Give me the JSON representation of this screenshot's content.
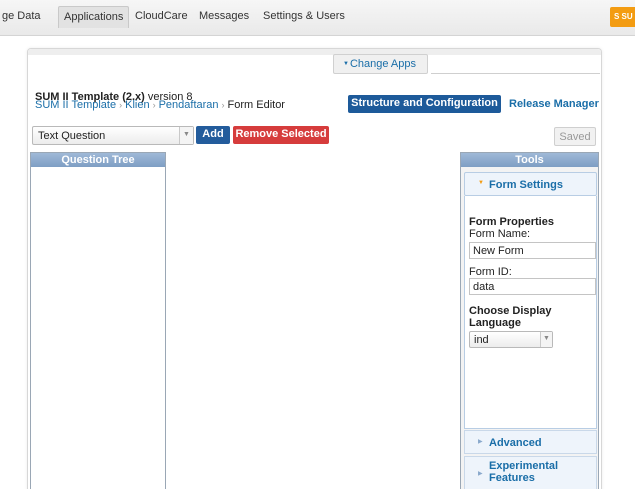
{
  "nav": {
    "items": [
      "ge Data",
      "Applications",
      "CloudCare",
      "Messages",
      "Settings & Users"
    ],
    "active_index": 1,
    "corner_badge": "S SU"
  },
  "app": {
    "title_bold": "SUM II Template (2.x)",
    "title_version": "version 8",
    "change_apps": "Change Apps"
  },
  "breadcrumb": {
    "items": [
      "SUM II Template",
      "Klien",
      "Pendaftaran",
      "Form Editor"
    ],
    "separator": "›"
  },
  "actions": {
    "structure": "Structure and Configuration",
    "release": "Release Manager"
  },
  "toolbar": {
    "question_type": "Text Question",
    "add": "Add",
    "remove": "Remove Selected",
    "saved": "Saved"
  },
  "question_tree": {
    "title": "Question Tree"
  },
  "tools": {
    "title": "Tools",
    "form_settings": "Form Settings",
    "form_properties": "Form Properties",
    "form_name_label": "Form Name:",
    "form_name_value": "New Form",
    "form_id_label": "Form ID:",
    "form_id_value": "data",
    "choose_language": "Choose Display Language",
    "language_value": "ind",
    "advanced": "Advanced",
    "experimental": "Experimental Features"
  },
  "colors": {
    "primary_blue": "#1d5a9a",
    "danger_red": "#d63c3c",
    "link_blue": "#1a6ea8",
    "panel_header": "#8fabcd",
    "accent_orange": "#f39c12"
  }
}
